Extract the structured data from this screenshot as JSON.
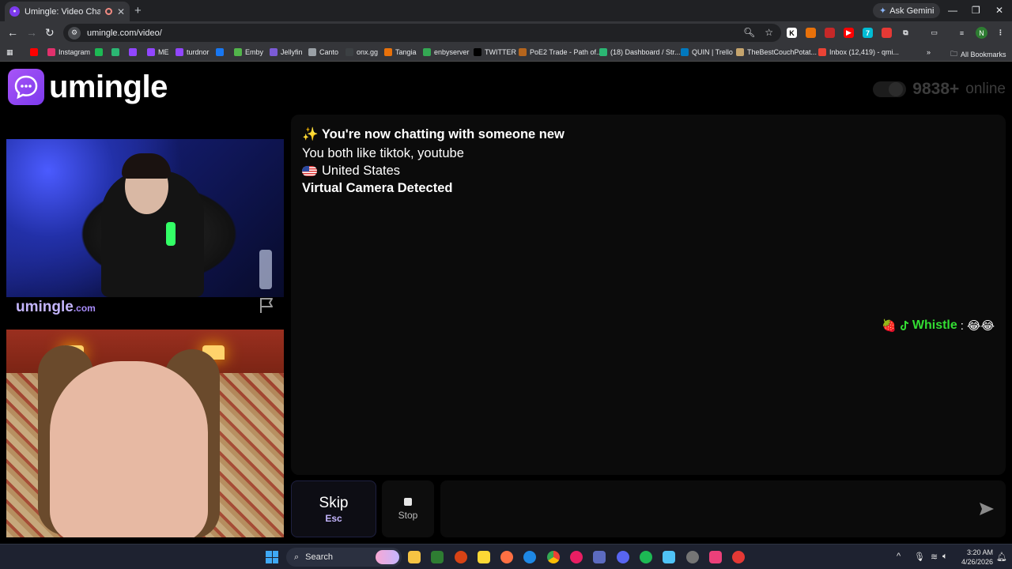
{
  "browser": {
    "tab_title": "Umingle: Video Chat with S",
    "ask_gemini": "Ask Gemini",
    "url": "umingle.com/video/",
    "bookmarks": [
      {
        "label": "",
        "color": "#ff0000"
      },
      {
        "label": "Instagram",
        "color": "#e1306c"
      },
      {
        "label": "",
        "color": "#1db954"
      },
      {
        "label": "",
        "color": "#2bb673"
      },
      {
        "label": "",
        "color": "#9146ff"
      },
      {
        "label": "ME",
        "color": "#9146ff"
      },
      {
        "label": "turdnor",
        "color": "#9146ff"
      },
      {
        "label": "",
        "color": "#1877f2"
      },
      {
        "label": "Emby",
        "color": "#52b54b"
      },
      {
        "label": "Jellyfin",
        "color": "#7b5bd6"
      },
      {
        "label": "Canto",
        "color": "#9aa0a6"
      },
      {
        "label": "onx.gg",
        "color": "#3c4043"
      },
      {
        "label": "Tangia",
        "color": "#e8710a"
      },
      {
        "label": "enbyserver",
        "color": "#34a853"
      },
      {
        "label": "TWITTER",
        "color": "#000000"
      },
      {
        "label": "PoE2 Trade - Path of...",
        "color": "#b5651d"
      },
      {
        "label": "(18) Dashboard / Str...",
        "color": "#2bb673"
      },
      {
        "label": "QUIN | Trello",
        "color": "#0079bf"
      },
      {
        "label": "TheBestCouchPotat...",
        "color": "#c5a46d"
      },
      {
        "label": "Inbox (12,419) - qmi...",
        "color": "#ea4335"
      }
    ],
    "all_bookmarks": "All Bookmarks"
  },
  "header": {
    "logo_text": "umingle",
    "online_count": "9838+",
    "online_label": "online"
  },
  "video": {
    "brand": "umingle",
    "brand_suffix": ".com"
  },
  "chat": {
    "intro_icon": "sparkles-icon",
    "intro": "✨ You're now chatting with someone new",
    "interests": "You both like tiktok, youtube",
    "country": "United States",
    "notice": "Virtual Camera Detected",
    "messages": [
      {
        "badge": "🍓",
        "platform": "tiktok-icon",
        "name": "Whistle",
        "text": "😂😂"
      }
    ]
  },
  "controls": {
    "skip_label": "Skip",
    "skip_hotkey": "Esc",
    "stop_label": "Stop",
    "input_value": "",
    "input_placeholder": ""
  },
  "taskbar": {
    "search_label": "Search",
    "time": "3:20 AM",
    "date": "4/26/2026"
  },
  "colors": {
    "brand_purple": "#7c3aed",
    "username_green": "#33dd33"
  }
}
